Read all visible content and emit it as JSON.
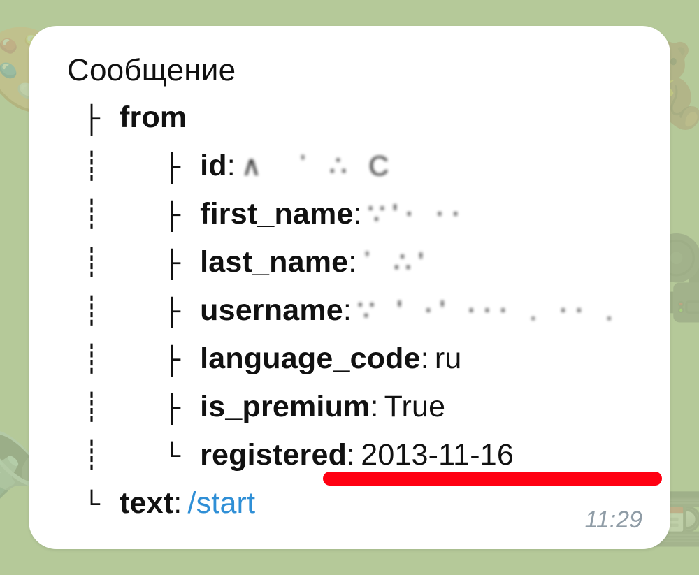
{
  "message": {
    "root": "Сообщение",
    "from_label": "from",
    "fields": {
      "id": {
        "key": "id",
        "value": ""
      },
      "first_name": {
        "key": "first_name",
        "value": ""
      },
      "last_name": {
        "key": "last_name",
        "value": ""
      },
      "username": {
        "key": "username",
        "value": ""
      },
      "language_code": {
        "key": "language_code",
        "value": "ru"
      },
      "is_premium": {
        "key": "is_premium",
        "value": "True"
      },
      "registered": {
        "key": "registered",
        "value": "2013-11-16"
      }
    },
    "text": {
      "key": "text",
      "value": "/start"
    }
  },
  "timestamp": "11:29",
  "branches": {
    "mid1": " ├ ",
    "mid2": " ┊    ├ ",
    "last2": " ┊    └ ",
    "last1": " └ "
  }
}
